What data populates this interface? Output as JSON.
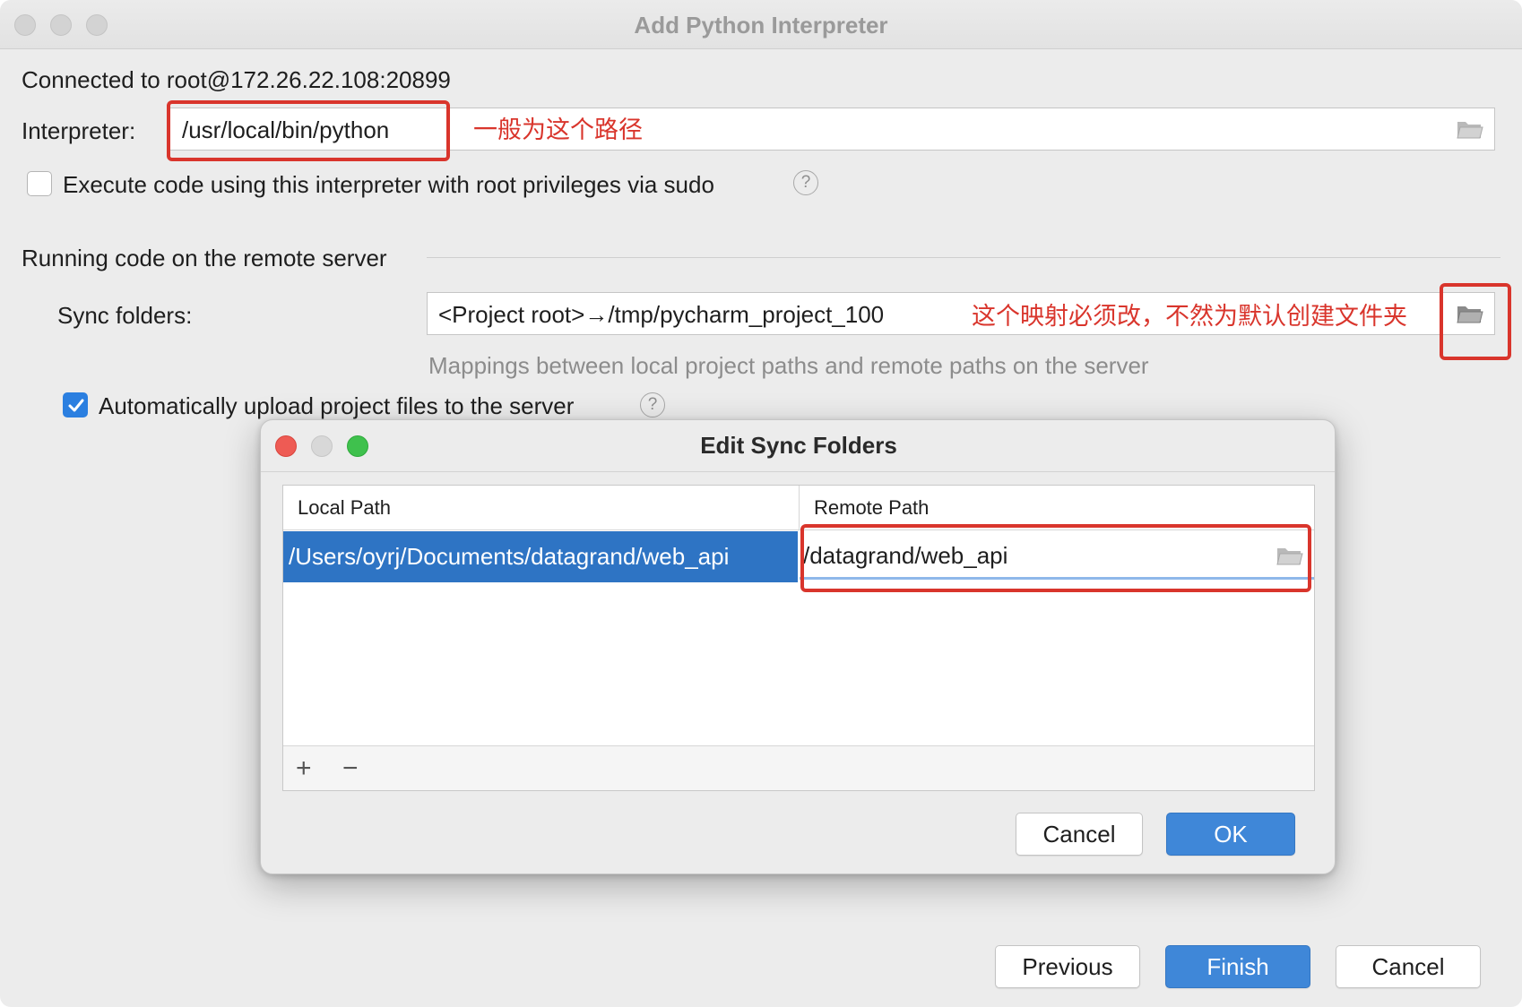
{
  "window": {
    "title": "Add Python Interpreter"
  },
  "connection": {
    "text": "Connected to root@172.26.22.108:20899"
  },
  "interpreter": {
    "label": "Interpreter:",
    "value": "/usr/local/bin/python",
    "annotation": "一般为这个路径",
    "browse_icon": "folder-open-icon"
  },
  "sudo_option": {
    "label": "Execute code using this interpreter with root privileges via sudo",
    "checked": false,
    "help_icon": "question-icon"
  },
  "remote_section": {
    "title": "Running code on the remote server",
    "sync_label": "Sync folders:",
    "sync_value": "<Project root>→/tmp/pycharm_project_100",
    "sync_annotation": "这个映射必须改，不然为默认创建文件夹",
    "sync_hint": "Mappings between local project paths and remote paths on the server",
    "auto_upload_label": "Automatically upload project files to the server",
    "auto_upload_checked": true
  },
  "footer": {
    "previous_label": "Previous",
    "finish_label": "Finish",
    "cancel_label": "Cancel"
  },
  "modal": {
    "title": "Edit Sync Folders",
    "columns": [
      "Local Path",
      "Remote Path"
    ],
    "rows": [
      {
        "local": "/Users/oyrj/Documents/datagrand/web_api",
        "remote": "/datagrand/web_api"
      }
    ],
    "add_icon": "+",
    "remove_icon": "−",
    "cancel_label": "Cancel",
    "ok_label": "OK"
  },
  "colors": {
    "annotation_red": "#d9352c",
    "accent_blue": "#3f87d8",
    "selection_blue": "#2e74c4"
  }
}
